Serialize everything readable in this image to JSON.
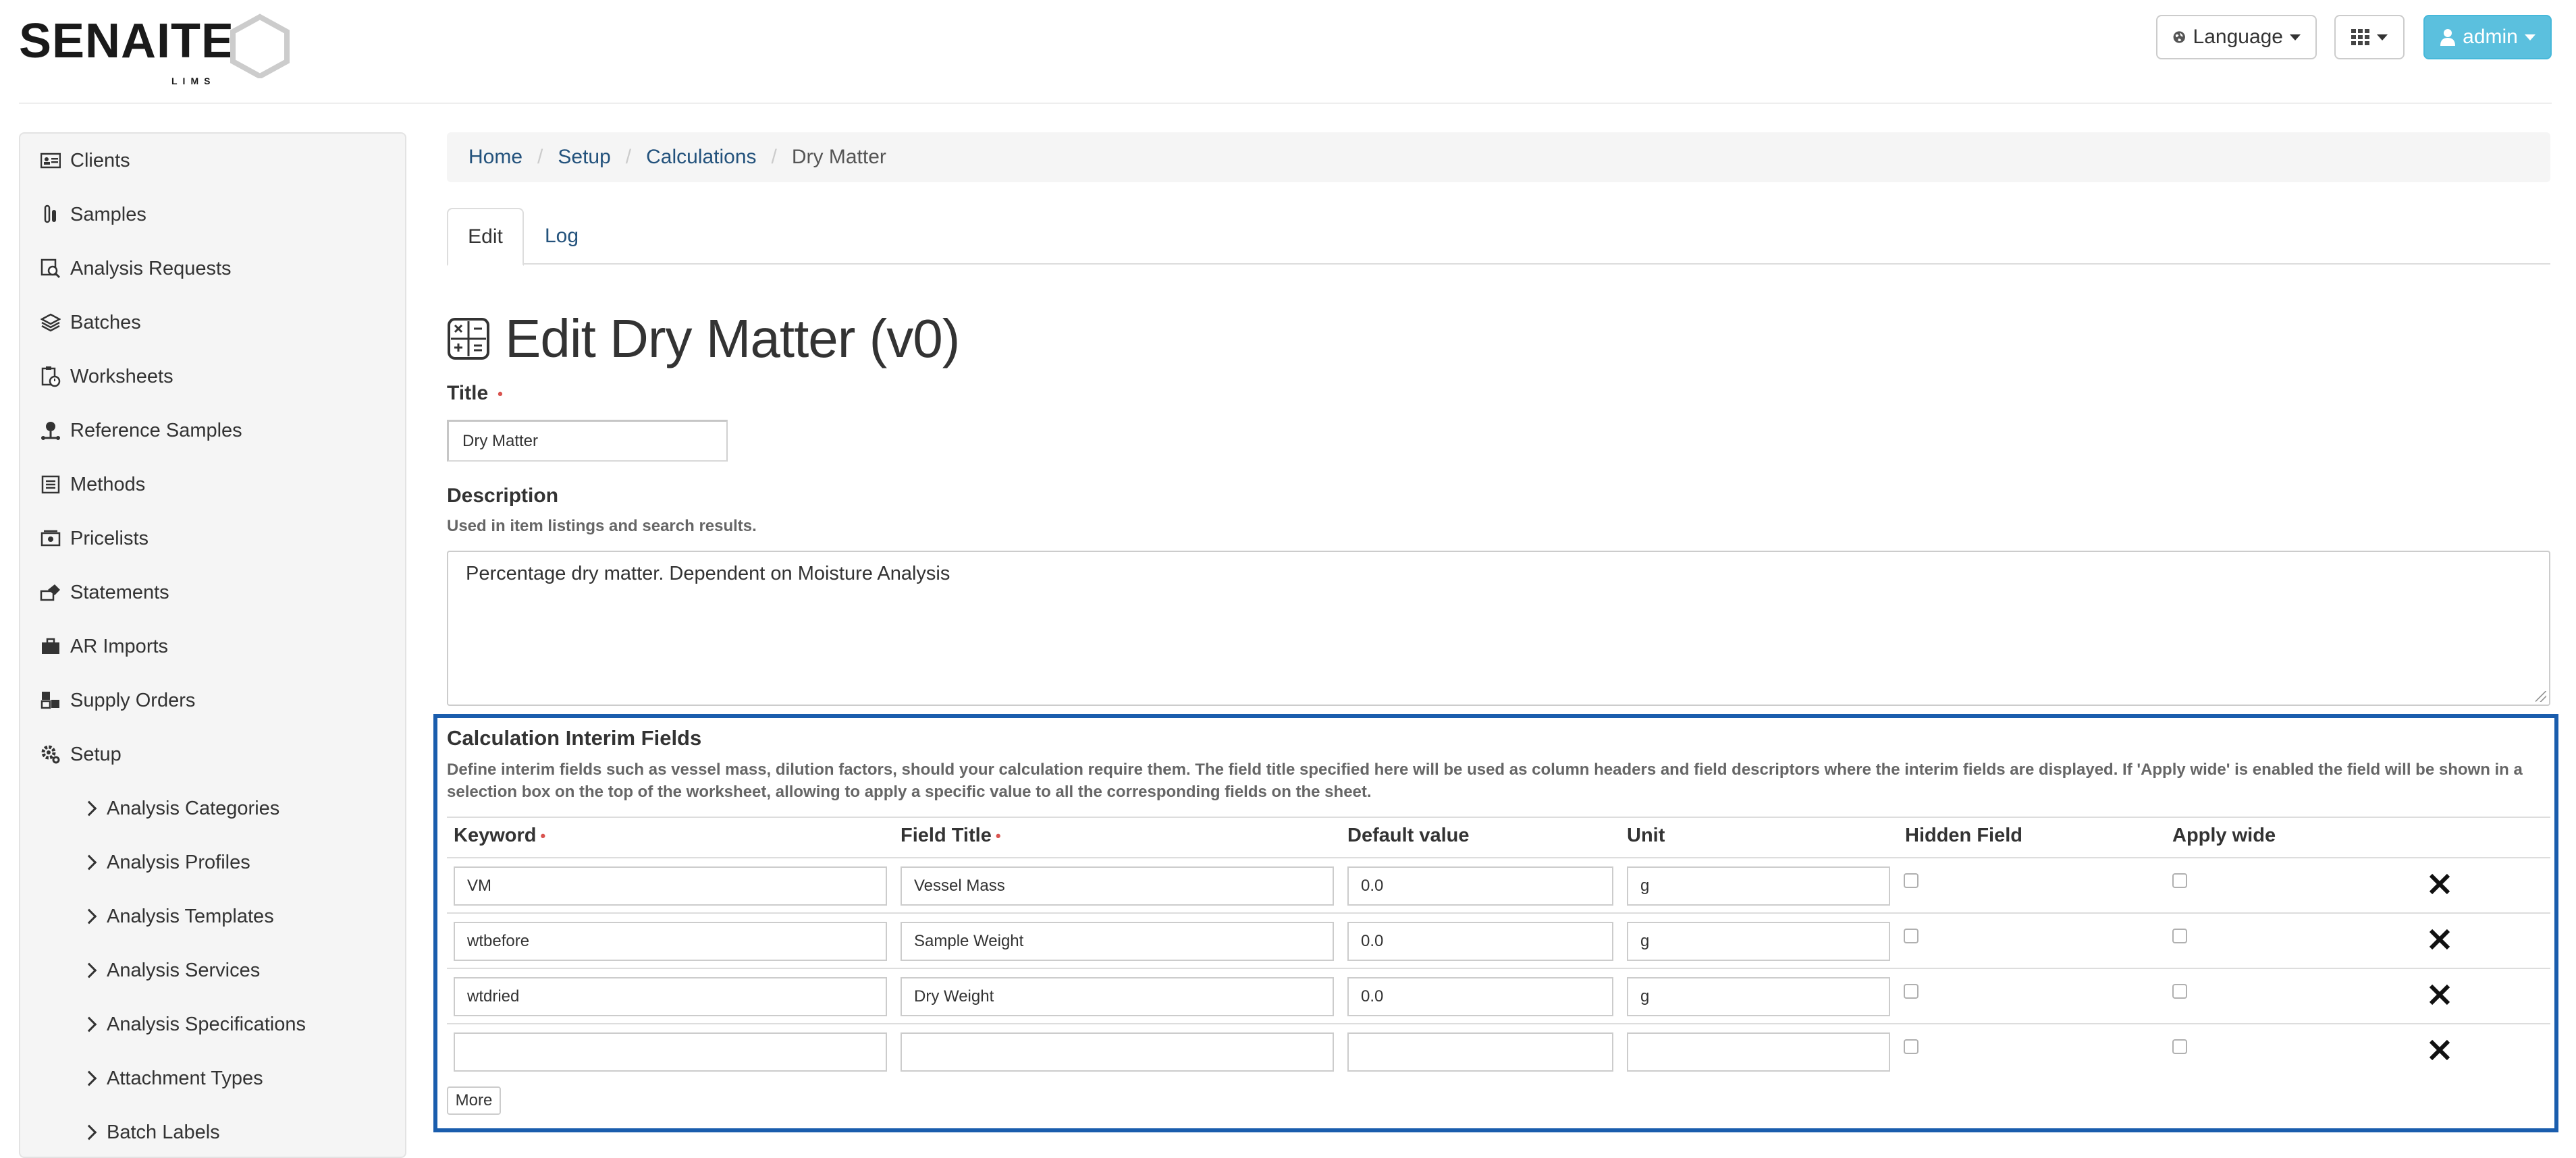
{
  "header": {
    "logo_text": "SENAITE",
    "logo_sub": "LIMS",
    "language_label": "Language",
    "user_label": "admin",
    "accent_color": "#5bc0de"
  },
  "sidebar": {
    "items": [
      {
        "label": "Clients",
        "icon": "id-card-icon"
      },
      {
        "label": "Samples",
        "icon": "sample-tubes-icon"
      },
      {
        "label": "Analysis Requests",
        "icon": "search-document-icon"
      },
      {
        "label": "Batches",
        "icon": "layers-icon"
      },
      {
        "label": "Worksheets",
        "icon": "clipboard-clock-icon"
      },
      {
        "label": "Reference Samples",
        "icon": "reference-sample-icon"
      },
      {
        "label": "Methods",
        "icon": "list-icon"
      },
      {
        "label": "Pricelists",
        "icon": "price-icon"
      },
      {
        "label": "Statements",
        "icon": "statements-icon"
      },
      {
        "label": "AR Imports",
        "icon": "briefcase-icon"
      },
      {
        "label": "Supply Orders",
        "icon": "supply-icon"
      },
      {
        "label": "Setup",
        "icon": "gear-icon"
      }
    ],
    "setup_children": [
      "Analysis Categories",
      "Analysis Profiles",
      "Analysis Templates",
      "Analysis Services",
      "Analysis Specifications",
      "Attachment Types",
      "Batch Labels"
    ]
  },
  "breadcrumb": {
    "home": "Home",
    "setup": "Setup",
    "calculations": "Calculations",
    "current": "Dry Matter"
  },
  "tabs": {
    "edit": "Edit",
    "log": "Log"
  },
  "page": {
    "title": "Edit Dry Matter (v0)"
  },
  "form": {
    "title_label": "Title",
    "required_marker": "•",
    "title_value": "Dry Matter",
    "description_label": "Description",
    "description_help": "Used in item listings and search results.",
    "description_value": "Percentage dry matter. Dependent on Moisture Analysis"
  },
  "interim": {
    "title": "Calculation Interim Fields",
    "help": "Define interim fields such as vessel mass, dilution factors, should your calculation require them. The field title specified here will be used as column headers and field descriptors where the interim fields are displayed. If 'Apply wide' is enabled the field will be shown in a selection box on the top of the worksheet, allowing to apply a specific value to all the corresponding fields on the sheet.",
    "columns": {
      "keyword": "Keyword",
      "field_title": "Field Title",
      "default_value": "Default value",
      "unit": "Unit",
      "hidden": "Hidden Field",
      "apply_wide": "Apply wide"
    },
    "rows": [
      {
        "keyword": "VM",
        "title": "Vessel Mass",
        "value": "0.0",
        "unit": "g"
      },
      {
        "keyword": "wtbefore",
        "title": "Sample Weight",
        "value": "0.0",
        "unit": "g"
      },
      {
        "keyword": "wtdried",
        "title": "Dry Weight",
        "value": "0.0",
        "unit": "g"
      },
      {
        "keyword": "",
        "title": "",
        "value": "",
        "unit": ""
      }
    ],
    "more_label": "More",
    "highlight_color": "#1a5dad"
  }
}
